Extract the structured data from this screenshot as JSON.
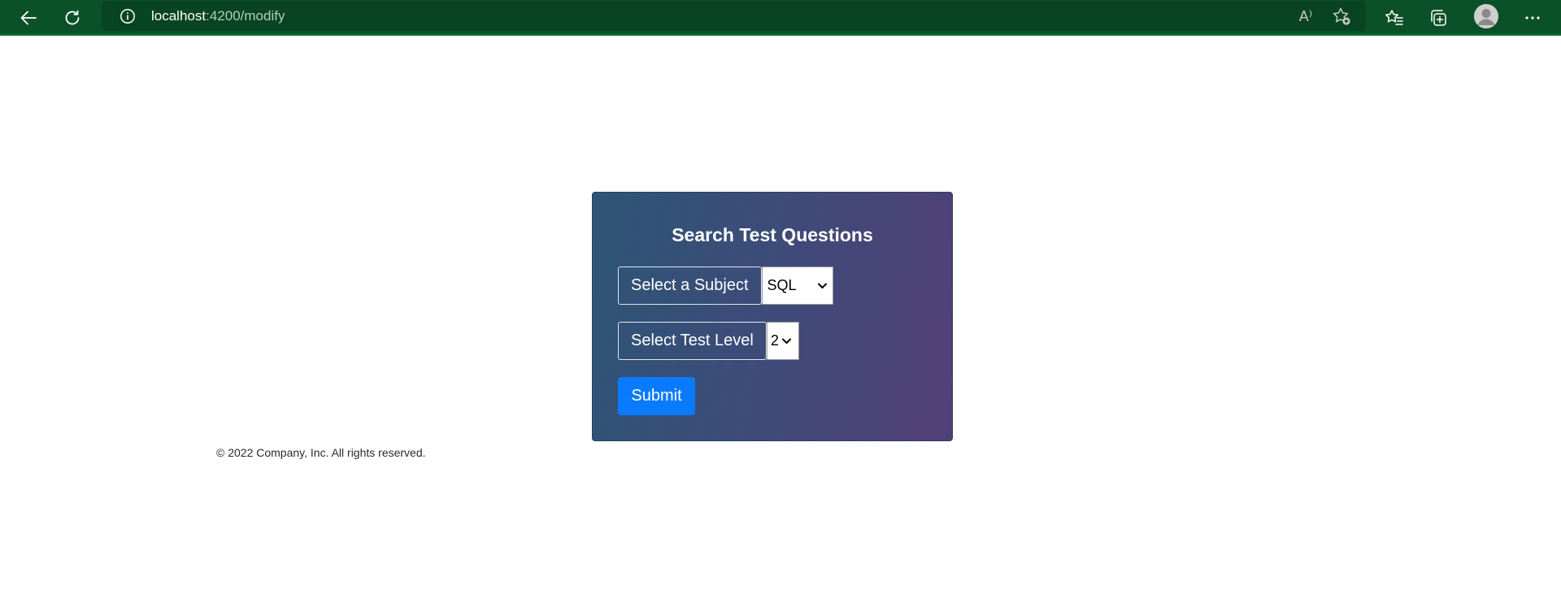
{
  "browser": {
    "url_host": "localhost",
    "url_path": ":4200/modify",
    "icons": [
      "back-icon",
      "refresh-icon",
      "info-icon",
      "read-aloud-icon",
      "add-favorite-icon",
      "favorites-icon",
      "collections-icon",
      "profile-icon",
      "more-icon"
    ],
    "read_aloud_glyph": "A⁾"
  },
  "form": {
    "title": "Search Test Questions",
    "subject_label": "Select a Subject",
    "subject_value": "SQL",
    "level_label": "Select Test Level",
    "level_value": "2",
    "submit_label": "Submit"
  },
  "footer": {
    "text": "© 2022 Company, Inc. All rights reserved."
  },
  "colors": {
    "toolbar": "#0b5128",
    "address_bar": "#084421",
    "submit": "#0a7bff",
    "card_gradient_start": "#2d5576",
    "card_gradient_end": "#533f78"
  }
}
